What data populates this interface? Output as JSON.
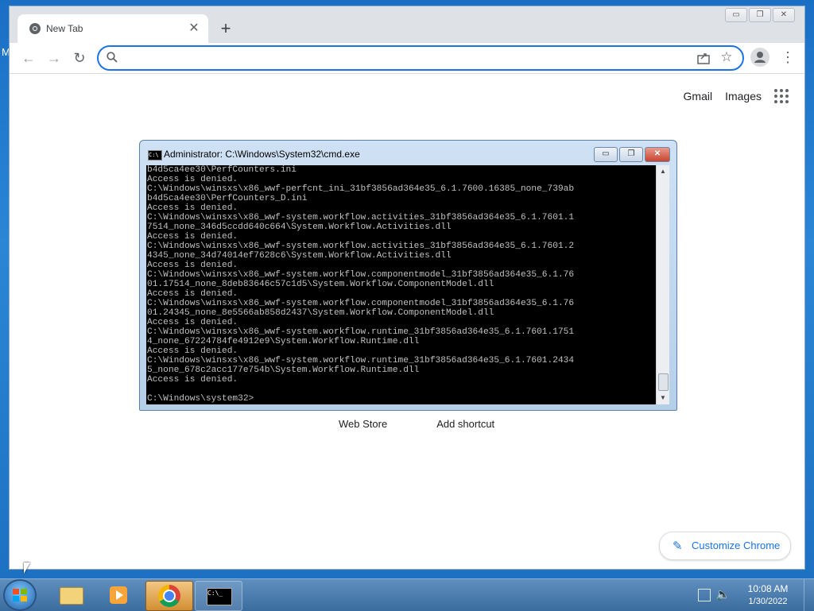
{
  "desktop": {
    "edge_label": "M"
  },
  "browser": {
    "tab_title": "New Tab",
    "tab_close": "✕",
    "new_tab": "+",
    "window_controls": [
      "▭",
      "❐",
      "✕"
    ],
    "nav": {
      "back": "←",
      "forward": "→",
      "reload": "↻"
    },
    "omnibox": {
      "value": "",
      "placeholder": ""
    },
    "menu": "⋮"
  },
  "newtab_page": {
    "gmail_label": "Gmail",
    "images_label": "Images",
    "shortcuts": [
      "Web Store",
      "Add shortcut"
    ],
    "customize_label": "Customize Chrome",
    "customize_icon": "✎"
  },
  "cmd": {
    "title": "Administrator: C:\\Windows\\System32\\cmd.exe",
    "icon_text": "C:\\",
    "controls": [
      "▭",
      "❐",
      "✕"
    ],
    "lines": [
      "b4d5ca4ee30\\PerfCounters.ini",
      "Access is denied.",
      "C:\\Windows\\winsxs\\x86_wwf-perfcnt_ini_31bf3856ad364e35_6.1.7600.16385_none_739ab",
      "b4d5ca4ee30\\PerfCounters_D.ini",
      "Access is denied.",
      "C:\\Windows\\winsxs\\x86_wwf-system.workflow.activities_31bf3856ad364e35_6.1.7601.1",
      "7514_none_346d5ccdd640c664\\System.Workflow.Activities.dll",
      "Access is denied.",
      "C:\\Windows\\winsxs\\x86_wwf-system.workflow.activities_31bf3856ad364e35_6.1.7601.2",
      "4345_none_34d74014ef7628c6\\System.Workflow.Activities.dll",
      "Access is denied.",
      "C:\\Windows\\winsxs\\x86_wwf-system.workflow.componentmodel_31bf3856ad364e35_6.1.76",
      "01.17514_none_8deb83646c57c1d5\\System.Workflow.ComponentModel.dll",
      "Access is denied.",
      "C:\\Windows\\winsxs\\x86_wwf-system.workflow.componentmodel_31bf3856ad364e35_6.1.76",
      "01.24345_none_8e5566ab858d2437\\System.Workflow.ComponentModel.dll",
      "Access is denied.",
      "C:\\Windows\\winsxs\\x86_wwf-system.workflow.runtime_31bf3856ad364e35_6.1.7601.1751",
      "4_none_67224784fe4912e9\\System.Workflow.Runtime.dll",
      "Access is denied.",
      "C:\\Windows\\winsxs\\x86_wwf-system.workflow.runtime_31bf3856ad364e35_6.1.7601.2434",
      "5_none_678c2acc177e754b\\System.Workflow.Runtime.dll",
      "Access is denied.",
      "",
      "C:\\Windows\\system32>"
    ],
    "scrollbar": {
      "up": "▲",
      "down": "▼"
    }
  },
  "taskbar": {
    "items": [
      "windows-explorer",
      "media-player",
      "google-chrome",
      "command-prompt"
    ],
    "cmd_icon_text": "C:\\_",
    "volume_icon": "🔈",
    "clock_time": "10:08 AM",
    "clock_date": "1/30/2022"
  }
}
